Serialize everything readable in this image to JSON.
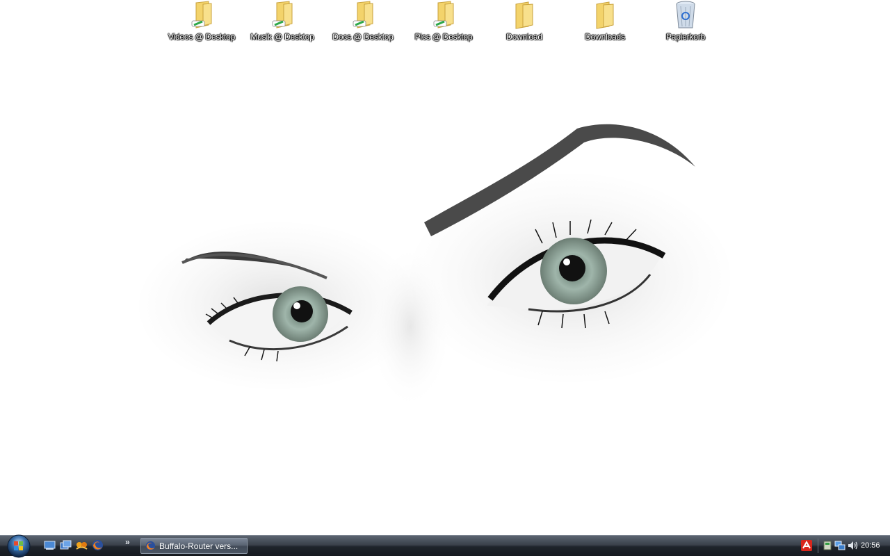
{
  "desktop": {
    "icons": [
      {
        "label": "Videos @ Desktop",
        "icon": "folder-shortcut-icon"
      },
      {
        "label": "Musik @ Desktop",
        "icon": "folder-shortcut-icon"
      },
      {
        "label": "Docs @ Desktop",
        "icon": "folder-shortcut-icon"
      },
      {
        "label": "Pics @ Desktop",
        "icon": "folder-shortcut-icon"
      },
      {
        "label": "Download",
        "icon": "folder-icon"
      },
      {
        "label": "Downloads",
        "icon": "folder-icon"
      },
      {
        "label": "Papierkorb",
        "icon": "recycle-bin-icon"
      }
    ],
    "wallpaper": "eyes-wallpaper"
  },
  "taskbar": {
    "start_icon": "windows-start-orb-icon",
    "quick_launch": [
      "show-desktop-icon",
      "switch-windows-icon",
      "messenger-icon",
      "firefox-icon"
    ],
    "quick_launch_more": "»",
    "tasks": [
      {
        "label": "Buffalo-Router vers...",
        "icon": "firefox-icon"
      }
    ],
    "tray": {
      "icons": [
        "antivirus-icon",
        "safely-remove-hardware-icon",
        "network-icon",
        "volume-icon"
      ],
      "clock": "20:56"
    }
  },
  "colors": {
    "taskbar_dark": "#161a20",
    "taskbar_light": "#5b6470",
    "folder_yellow": "#f2d56b",
    "eye_green": "#8fa59a"
  }
}
